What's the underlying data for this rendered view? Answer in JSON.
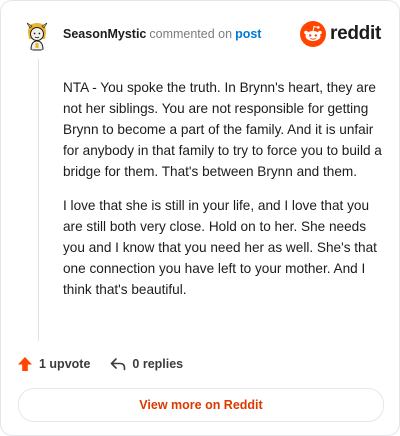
{
  "comment": {
    "username": "SeasonMystic",
    "action_text": "commented on",
    "post_link": "post",
    "paragraphs": [
      "NTA - You spoke the truth. In Brynn's heart, they are not her siblings. You are not responsible for getting Brynn to become a part of the family. And it is unfair for anybody in that family to try to force you to build a bridge for them. That's between Brynn and them.",
      "I love that she is still in your life, and I love that you are still both very close. Hold on to her. She needs you and I know that you need her as well. She's that one connection you have left to your mother. And I think that's beautiful."
    ]
  },
  "brand": {
    "name": "reddit",
    "icon": "reddit-snoo-icon",
    "color": "#ff4500"
  },
  "actions": {
    "upvote_label": "1 upvote",
    "upvote_icon": "upvote-arrow-icon",
    "upvote_color": "#ff4500",
    "reply_label": "0 replies",
    "reply_icon": "reply-arrow-icon"
  },
  "cta": {
    "label": "View more on Reddit",
    "color": "#d93a00"
  }
}
